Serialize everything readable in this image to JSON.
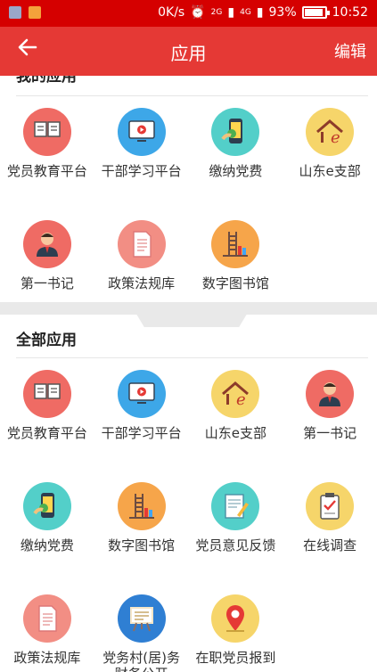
{
  "status": {
    "speed": "0K/s",
    "net_2g": "2G",
    "net_4g": "4G",
    "battery": "93%",
    "battery_level": 0.93,
    "time": "10:52"
  },
  "appbar": {
    "back_icon": "arrow-left-icon",
    "title": "应用",
    "edit": "编辑"
  },
  "my_apps": {
    "title": "我的应用",
    "items": [
      {
        "label": "党员教育平台",
        "icon": "open-book-icon",
        "color": "#ef6b64"
      },
      {
        "label": "干部学习平台",
        "icon": "video-monitor-icon",
        "color": "#3da7e8"
      },
      {
        "label": "缴纳党费",
        "icon": "phone-payment-icon",
        "color": "#53cfc9"
      },
      {
        "label": "山东e支部",
        "icon": "home-e-logo-icon",
        "color": "#f6d56a"
      },
      {
        "label": "第一书记",
        "icon": "person-avatar-icon",
        "color": "#ef6b64"
      },
      {
        "label": "政策法规库",
        "icon": "document-icon",
        "color": "#f28e84"
      },
      {
        "label": "数字图书馆",
        "icon": "library-ladder-icon",
        "color": "#f6a54a"
      }
    ]
  },
  "all_apps": {
    "title": "全部应用",
    "items": [
      {
        "label": "党员教育平台",
        "icon": "open-book-icon",
        "color": "#ef6b64"
      },
      {
        "label": "干部学习平台",
        "icon": "video-monitor-icon",
        "color": "#3da7e8"
      },
      {
        "label": "山东e支部",
        "icon": "home-e-logo-icon",
        "color": "#f6d56a"
      },
      {
        "label": "第一书记",
        "icon": "person-avatar-icon",
        "color": "#ef6b64"
      },
      {
        "label": "缴纳党费",
        "icon": "phone-payment-icon",
        "color": "#53cfc9"
      },
      {
        "label": "数字图书馆",
        "icon": "library-ladder-icon",
        "color": "#f6a54a"
      },
      {
        "label": "党员意见反馈",
        "icon": "notepad-pencil-icon",
        "color": "#53cfc9"
      },
      {
        "label": "在线调查",
        "icon": "clipboard-check-icon",
        "color": "#f6d56a"
      },
      {
        "label": "政策法规库",
        "icon": "document-icon",
        "color": "#f28e84"
      },
      {
        "label": "党务村(居)务财务公开",
        "icon": "presentation-board-icon",
        "color": "#2f7fd3"
      },
      {
        "label": "在职党员报到",
        "icon": "location-pin-icon",
        "color": "#f6d56a"
      }
    ]
  }
}
